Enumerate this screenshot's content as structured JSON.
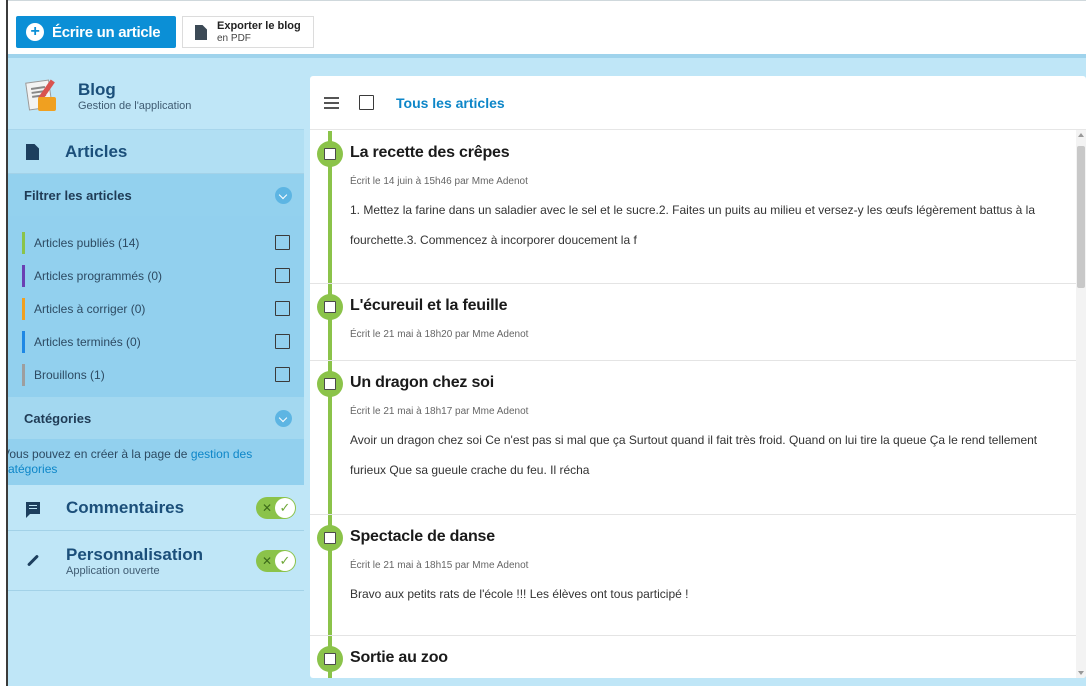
{
  "toolbar": {
    "write_label": "Écrire un article",
    "export_line1": "Exporter le blog",
    "export_line2": "en PDF"
  },
  "sidebar": {
    "blog_title": "Blog",
    "blog_subtitle": "Gestion de l'application",
    "articles_label": "Articles",
    "filter_title": "Filtrer les articles",
    "filters": [
      {
        "label": "Articles publiés (14)",
        "color": "#8bc34a"
      },
      {
        "label": "Articles programmés (0)",
        "color": "#6a3fb3"
      },
      {
        "label": "Articles à corriger (0)",
        "color": "#f0a020"
      },
      {
        "label": "Articles terminés (0)",
        "color": "#1e88e5"
      },
      {
        "label": "Brouillons (1)",
        "color": "#9e9e9e"
      }
    ],
    "categories_title": "Catégories",
    "categories_info": "Vous pouvez en créer à la page de",
    "categories_link": "gestion des catégories",
    "comments_label": "Commentaires",
    "custom_label": "Personnalisation",
    "custom_sub": "Application ouverte"
  },
  "main": {
    "header_label": "Tous les articles",
    "articles": [
      {
        "title": "La recette des crêpes",
        "meta": "Écrit le 14 juin à 15h46 par Mme Adenot",
        "excerpt": "1. Mettez la farine dans un saladier avec le sel et le sucre.2. Faites un puits au milieu et versez-y les œufs légèrement battus à la fourchette.3. Commencez à incorporer doucement la f"
      },
      {
        "title": "L'écureuil et la feuille",
        "meta": "Écrit le 21 mai à 18h20 par Mme Adenot",
        "excerpt": ""
      },
      {
        "title": "Un dragon chez soi",
        "meta": "Écrit le 21 mai à 18h17 par Mme Adenot",
        "excerpt": "Avoir un dragon chez soi Ce n'est pas si mal que ça Surtout quand il fait très froid.    Quand on lui tire la queue Ça le rend tellement furieux Que sa gueule crache du feu.   Il récha"
      },
      {
        "title": "Spectacle de danse",
        "meta": "Écrit le 21 mai à 18h15 par Mme Adenot",
        "excerpt": "Bravo aux petits rats de l'école !!! Les élèves ont tous participé !"
      },
      {
        "title": "Sortie au zoo",
        "meta": "",
        "excerpt": ""
      }
    ]
  }
}
